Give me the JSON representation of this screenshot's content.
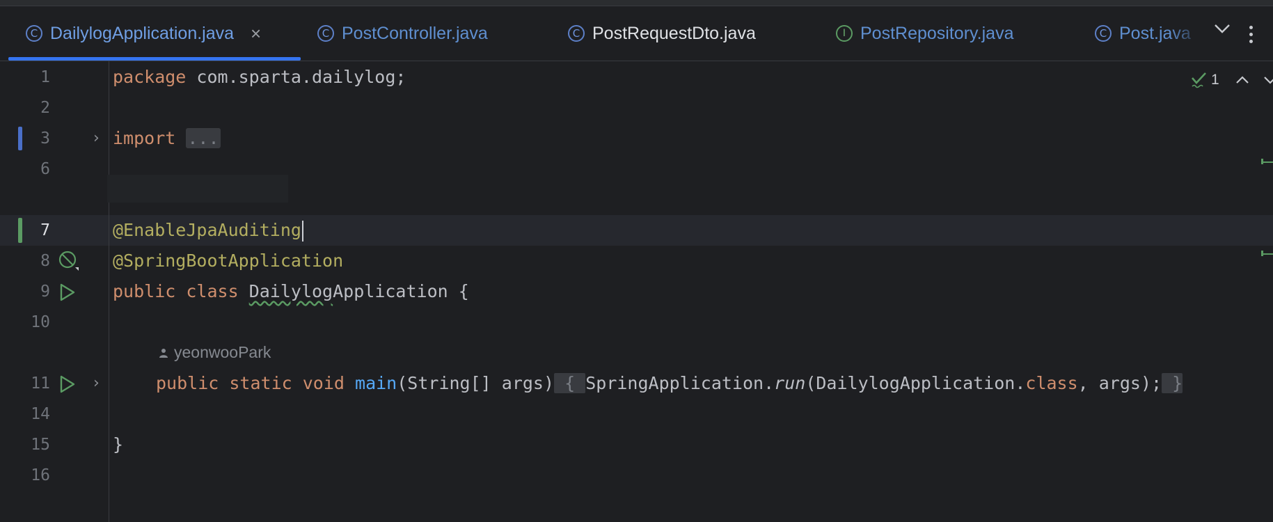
{
  "tabs": [
    {
      "label": "DailylogApplication.java",
      "icon": "class-run-icon",
      "active": true,
      "closable": true
    },
    {
      "label": "PostController.java",
      "icon": "class-icon",
      "active": false
    },
    {
      "label": "PostRequestDto.java",
      "icon": "class-icon",
      "active": false
    },
    {
      "label": "PostRepository.java",
      "icon": "interface-icon",
      "active": false
    },
    {
      "label": "Post.java",
      "icon": "class-icon",
      "active": false
    }
  ],
  "tab_icon_letters": {
    "class": "C",
    "interface": "I"
  },
  "tab_close_glyph": "×",
  "inspections": {
    "count": "1"
  },
  "editor": {
    "line_numbers": [
      "1",
      "2",
      "3",
      "6",
      "7",
      "8",
      "9",
      "10",
      "11",
      "14",
      "15",
      "16"
    ],
    "current_line": "7",
    "code": {
      "l1_kw": "package",
      "l1_rest": " com.sparta.dailylog;",
      "l3_kw": "import",
      "l3_fold": "...",
      "l7_annotation": "@EnableJpaAuditing",
      "l8_annotation": "@SpringBootApplication",
      "l9_kw1": "public",
      "l9_kw2": "class",
      "l9_name_a": "Dailylog",
      "l9_name_b": "Application",
      "l9_rest": " {",
      "l11_kw1": "public",
      "l11_kw2": "static",
      "l11_kw3": "void",
      "l11_fn": "main",
      "l11_params": "(String[] args)",
      "l11_open": "{",
      "l11_call_obj": "SpringApplication.",
      "l11_call_fn": "run",
      "l11_call_args1": "(DailylogApplication.",
      "l11_class_kw": "class",
      "l11_call_args2": ", args);",
      "l11_close": "}",
      "l15": "}"
    },
    "author_hint": "yeonwooPark"
  },
  "colors": {
    "background": "#1e1f22",
    "keyword": "#cf8e6d",
    "annotation": "#b3ae60",
    "function": "#56a8f5",
    "text": "#bcbec4",
    "accent": "#3574f0",
    "vcs_modified": "#4a6fc8",
    "vcs_added": "#5b9b63"
  }
}
